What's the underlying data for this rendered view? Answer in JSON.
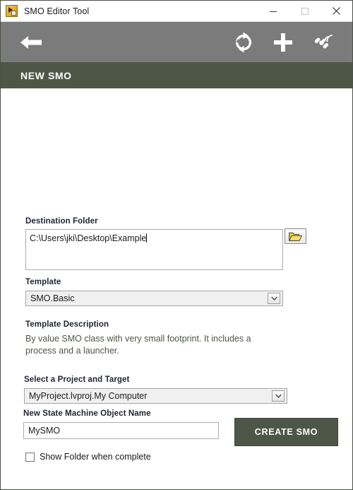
{
  "window": {
    "title": "SMO Editor Tool",
    "app_icon": "labview-app-icon",
    "controls": [
      {
        "name": "minimize-button",
        "icon": "minimize-icon"
      },
      {
        "name": "maximize-button",
        "icon": "maximize-icon"
      },
      {
        "name": "close-button",
        "icon": "close-icon"
      }
    ]
  },
  "toolbar": {
    "back_icon": "back-arrow-icon",
    "actions": [
      {
        "name": "refresh-button",
        "icon": "refresh-icon"
      },
      {
        "name": "add-button",
        "icon": "plus-icon"
      },
      {
        "name": "satellite-button",
        "icon": "satellite-icon"
      }
    ]
  },
  "section": {
    "title": "NEW SMO"
  },
  "form": {
    "destination": {
      "label": "Destination Folder",
      "value": "C:\\Users\\jki\\Desktop\\Example",
      "placeholder": "",
      "browse_icon": "open-folder-icon"
    },
    "template": {
      "label": "Template",
      "value": "SMO.Basic",
      "arrow_icon": "chevron-down-icon"
    },
    "template_description": {
      "label": "Template Description",
      "text": "By value SMO class with very small footprint. It includes a process and a launcher."
    },
    "project": {
      "label": "Select a Project and Target",
      "value": "MyProject.lvproj.My Computer",
      "arrow_icon": "chevron-down-icon"
    },
    "object_name": {
      "label": "New State Machine Object Name",
      "value": "MySMO",
      "placeholder": ""
    },
    "create": {
      "label": "CREATE SMO"
    },
    "show_folder": {
      "label": "Show Folder when complete",
      "checked": false
    }
  },
  "colors": {
    "accent_green": "#4e5648",
    "toolbar_gray": "#7b7b7b",
    "window_border": "#4a5148",
    "label_text": "#1f2430",
    "description_text": "#4e5648",
    "folder_icon_yellow": "#f2cc0c"
  }
}
